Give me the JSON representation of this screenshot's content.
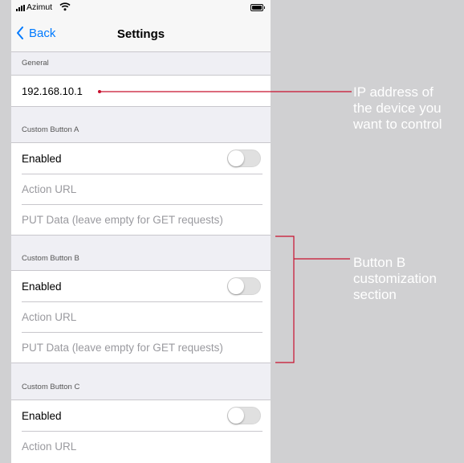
{
  "status_bar": {
    "carrier": "Azimut"
  },
  "nav": {
    "back_label": "Back",
    "title": "Settings"
  },
  "general": {
    "header": "General",
    "ip_value": "192.168.10.1"
  },
  "button_a": {
    "header": "Custom Button A",
    "enabled_label": "Enabled",
    "enabled": false,
    "action_url_placeholder": "Action URL",
    "put_data_placeholder": "PUT Data (leave empty for GET requests)"
  },
  "button_b": {
    "header": "Custom Button B",
    "enabled_label": "Enabled",
    "enabled": false,
    "action_url_placeholder": "Action URL",
    "put_data_placeholder": "PUT Data (leave empty for GET requests)"
  },
  "button_c": {
    "header": "Custom Button C",
    "enabled_label": "Enabled",
    "enabled": false,
    "action_url_placeholder": "Action URL"
  },
  "annotations": {
    "ip_note": {
      "line1": "IP address of",
      "line2": "the device you",
      "line3": "want to control"
    },
    "button_b_note": {
      "line1": "Button B",
      "line2": "customization",
      "line3": "section"
    }
  },
  "colors": {
    "annotation_line": "#c8102e",
    "accent": "#007aff",
    "annotation_text": "#ffffff"
  },
  "icons": {
    "signal": "signal-bars-icon",
    "wifi": "wifi-icon",
    "battery": "battery-icon",
    "back": "chevron-left-icon"
  }
}
